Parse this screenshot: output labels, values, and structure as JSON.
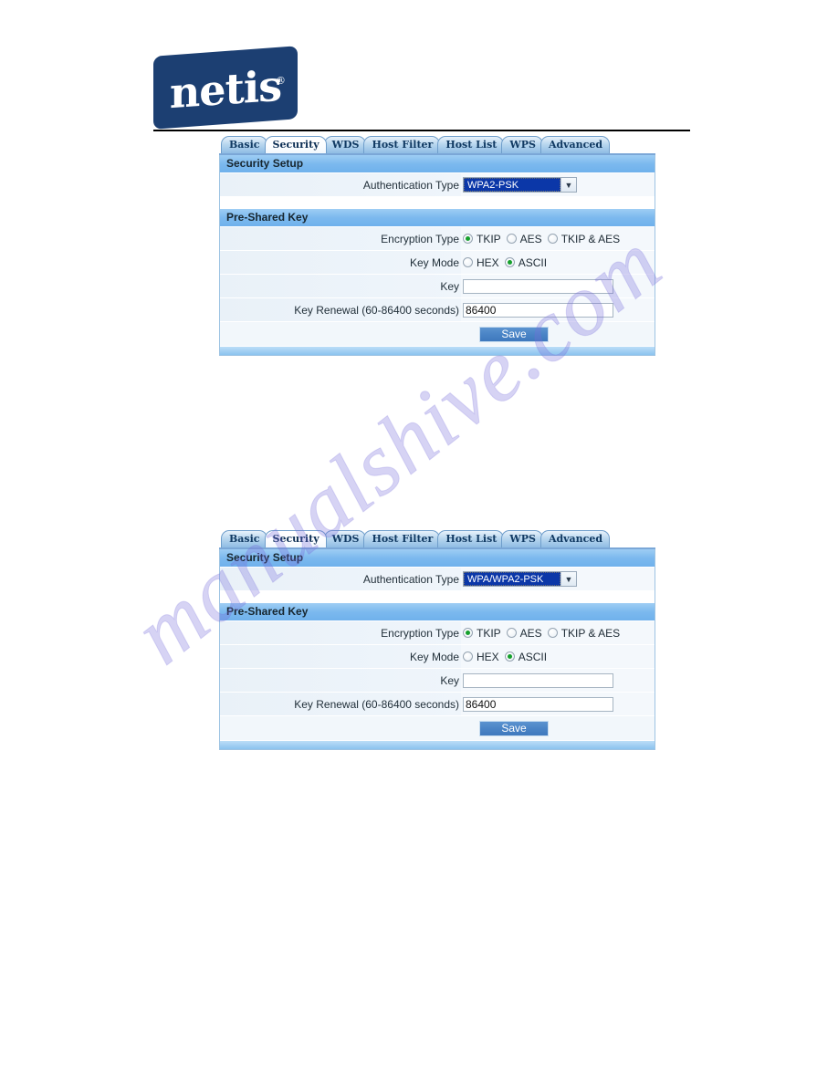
{
  "brand": {
    "logo_text": "netis",
    "registered_mark": "®"
  },
  "watermark": {
    "text": "manualshive.com"
  },
  "tabs": [
    {
      "label": "Basic",
      "active": false
    },
    {
      "label": "Security",
      "active": true
    },
    {
      "label": "WDS",
      "active": false
    },
    {
      "label": "Host Filter",
      "active": false
    },
    {
      "label": "Host List",
      "active": false
    },
    {
      "label": "WPS",
      "active": false
    },
    {
      "label": "Advanced",
      "active": false
    }
  ],
  "labels": {
    "security_setup": "Security Setup",
    "pre_shared_key": "Pre-Shared Key",
    "authentication_type": "Authentication Type",
    "encryption_type": "Encryption Type",
    "key_mode": "Key Mode",
    "key": "Key",
    "key_renewal": "Key Renewal (60-86400 seconds)",
    "save": "Save"
  },
  "encryption_options": [
    {
      "label": "TKIP",
      "selected": true
    },
    {
      "label": "AES",
      "selected": false
    },
    {
      "label": "TKIP & AES",
      "selected": false
    }
  ],
  "key_mode_options": [
    {
      "label": "HEX",
      "selected": false
    },
    {
      "label": "ASCII",
      "selected": true
    }
  ],
  "panels": [
    {
      "id": "panel-wpa2-psk",
      "authentication_type_value": "WPA2-PSK",
      "key_value": "",
      "key_placeholder": "",
      "key_renewal_value": "86400"
    },
    {
      "id": "panel-wpa-wpa2-psk",
      "authentication_type_value": "WPA/WPA2-PSK",
      "key_value": "",
      "key_placeholder": "",
      "key_renewal_value": "86400"
    }
  ],
  "colors": {
    "brand_navy": "#1c3f72",
    "section_header_blue": "#7cb9ee",
    "select_highlight": "#0b37a8",
    "radio_selected_green": "#15a02c",
    "save_button_blue": "#4a84c6",
    "watermark_purple": "#786ede"
  }
}
